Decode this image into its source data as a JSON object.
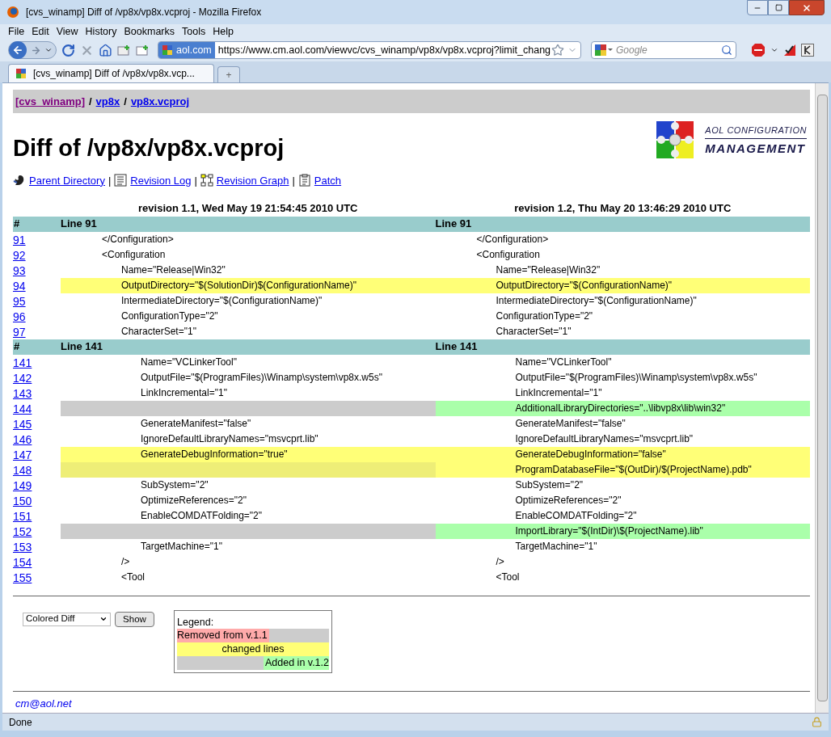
{
  "window": {
    "title": "[cvs_winamp] Diff of /vp8x/vp8x.vcproj - Mozilla Firefox"
  },
  "menu": [
    "File",
    "Edit",
    "View",
    "History",
    "Bookmarks",
    "Tools",
    "Help"
  ],
  "address_bar": {
    "site": "aol.com",
    "url": "https://www.cm.aol.com/viewvc/cvs_winamp/vp8x/vp8x.vcproj?limit_chang"
  },
  "search": {
    "placeholder": "Google"
  },
  "tabs": [
    {
      "label": "[cvs_winamp] Diff of /vp8x/vp8x.vcp...",
      "selected": true
    }
  ],
  "new_tab": "+",
  "breadcrumb": {
    "separator": "/",
    "items": [
      {
        "label": "[cvs_winamp]",
        "visited": true
      },
      {
        "label": "vp8x",
        "visited": false
      },
      {
        "label": "vp8x.vcproj",
        "visited": false
      }
    ]
  },
  "heading": "Diff of /vp8x/vp8x.vcproj",
  "logo": {
    "line_1": "AOL CONFIGURATION",
    "line_2": "MANAGEMENT"
  },
  "nav_links": {
    "separator": "|",
    "items": [
      "Parent Directory",
      "Revision Log",
      "Revision Graph",
      "Patch"
    ]
  },
  "diff": {
    "left_revision": "revision 1.1, Wed May 19 21:54:45 2010 UTC",
    "right_revision": "revision 1.2, Thu May 20 13:46:29 2010 UTC",
    "hunks": [
      {
        "hash": "#",
        "left_header": "Line 91",
        "right_header": "Line 91",
        "rows": [
          {
            "number": "91",
            "kind": "same",
            "left": "\t\t</Configuration>",
            "right": "\t\t</Configuration>"
          },
          {
            "number": "92",
            "kind": "same",
            "left": "\t\t<Configuration",
            "right": "\t\t<Configuration"
          },
          {
            "number": "93",
            "kind": "same",
            "left": "\t\t\tName=\"Release|Win32\"",
            "right": "\t\t\tName=\"Release|Win32\""
          },
          {
            "number": "94",
            "kind": "changed",
            "left": "\t\t\tOutputDirectory=\"$(SolutionDir)$(ConfigurationName)\"",
            "right": "\t\t\tOutputDirectory=\"$(ConfigurationName)\""
          },
          {
            "number": "95",
            "kind": "same",
            "left": "\t\t\tIntermediateDirectory=\"$(ConfigurationName)\"",
            "right": "\t\t\tIntermediateDirectory=\"$(ConfigurationName)\""
          },
          {
            "number": "96",
            "kind": "same",
            "left": "\t\t\tConfigurationType=\"2\"",
            "right": "\t\t\tConfigurationType=\"2\""
          },
          {
            "number": "97",
            "kind": "same",
            "left": "\t\t\tCharacterSet=\"1\"",
            "right": "\t\t\tCharacterSet=\"1\""
          }
        ]
      },
      {
        "hash": "#",
        "left_header": "Line 141",
        "right_header": "Line 141",
        "rows": [
          {
            "number": "141",
            "kind": "same",
            "left": "\t\t\t\tName=\"VCLinkerTool\"",
            "right": "\t\t\t\tName=\"VCLinkerTool\""
          },
          {
            "number": "142",
            "kind": "same",
            "left": "\t\t\t\tOutputFile=\"$(ProgramFiles)\\Winamp\\system\\vp8x.w5s\"",
            "right": "\t\t\t\tOutputFile=\"$(ProgramFiles)\\Winamp\\system\\vp8x.w5s\""
          },
          {
            "number": "143",
            "kind": "same",
            "left": "\t\t\t\tLinkIncremental=\"1\"",
            "right": "\t\t\t\tLinkIncremental=\"1\""
          },
          {
            "number": "144",
            "kind": "added",
            "right": "\t\t\t\tAdditionalLibraryDirectories=\"..\\libvp8x\\lib\\win32\""
          },
          {
            "number": "145",
            "kind": "same",
            "left": "\t\t\t\tGenerateManifest=\"false\"",
            "right": "\t\t\t\tGenerateManifest=\"false\""
          },
          {
            "number": "146",
            "kind": "same",
            "left": "\t\t\t\tIgnoreDefaultLibraryNames=\"msvcprt.lib\"",
            "right": "\t\t\t\tIgnoreDefaultLibraryNames=\"msvcprt.lib\""
          },
          {
            "number": "147",
            "kind": "changed",
            "left": "\t\t\t\tGenerateDebugInformation=\"true\"",
            "right": "\t\t\t\tGenerateDebugInformation=\"false\""
          },
          {
            "number": "148",
            "kind": "changed",
            "right": "\t\t\t\tProgramDatabaseFile=\"$(OutDir)/$(ProjectName).pdb\""
          },
          {
            "number": "149",
            "kind": "same",
            "left": "\t\t\t\tSubSystem=\"2\"",
            "right": "\t\t\t\tSubSystem=\"2\""
          },
          {
            "number": "150",
            "kind": "same",
            "left": "\t\t\t\tOptimizeReferences=\"2\"",
            "right": "\t\t\t\tOptimizeReferences=\"2\""
          },
          {
            "number": "151",
            "kind": "same",
            "left": "\t\t\t\tEnableCOMDATFolding=\"2\"",
            "right": "\t\t\t\tEnableCOMDATFolding=\"2\""
          },
          {
            "number": "152",
            "kind": "added",
            "right": "\t\t\t\tImportLibrary=\"$(IntDir)\\$(ProjectName).lib\""
          },
          {
            "number": "153",
            "kind": "same",
            "left": "\t\t\t\tTargetMachine=\"1\"",
            "right": "\t\t\t\tTargetMachine=\"1\""
          },
          {
            "number": "154",
            "kind": "same",
            "left": "\t\t\t/>",
            "right": "\t\t\t/>"
          },
          {
            "number": "155",
            "kind": "same",
            "left": "\t\t\t<Tool",
            "right": "\t\t\t<Tool"
          }
        ]
      }
    ]
  },
  "form": {
    "select": "Colored Diff",
    "button": "Show"
  },
  "legend": {
    "title": "Legend:",
    "items": [
      {
        "kind": "removed",
        "label": "Removed from v.1.1"
      },
      {
        "kind": "changed",
        "label": "changed lines"
      },
      {
        "kind": "added",
        "label": "Added in v.1.2"
      }
    ]
  },
  "footer": "cm@aol.net",
  "status_bar": "Done"
}
